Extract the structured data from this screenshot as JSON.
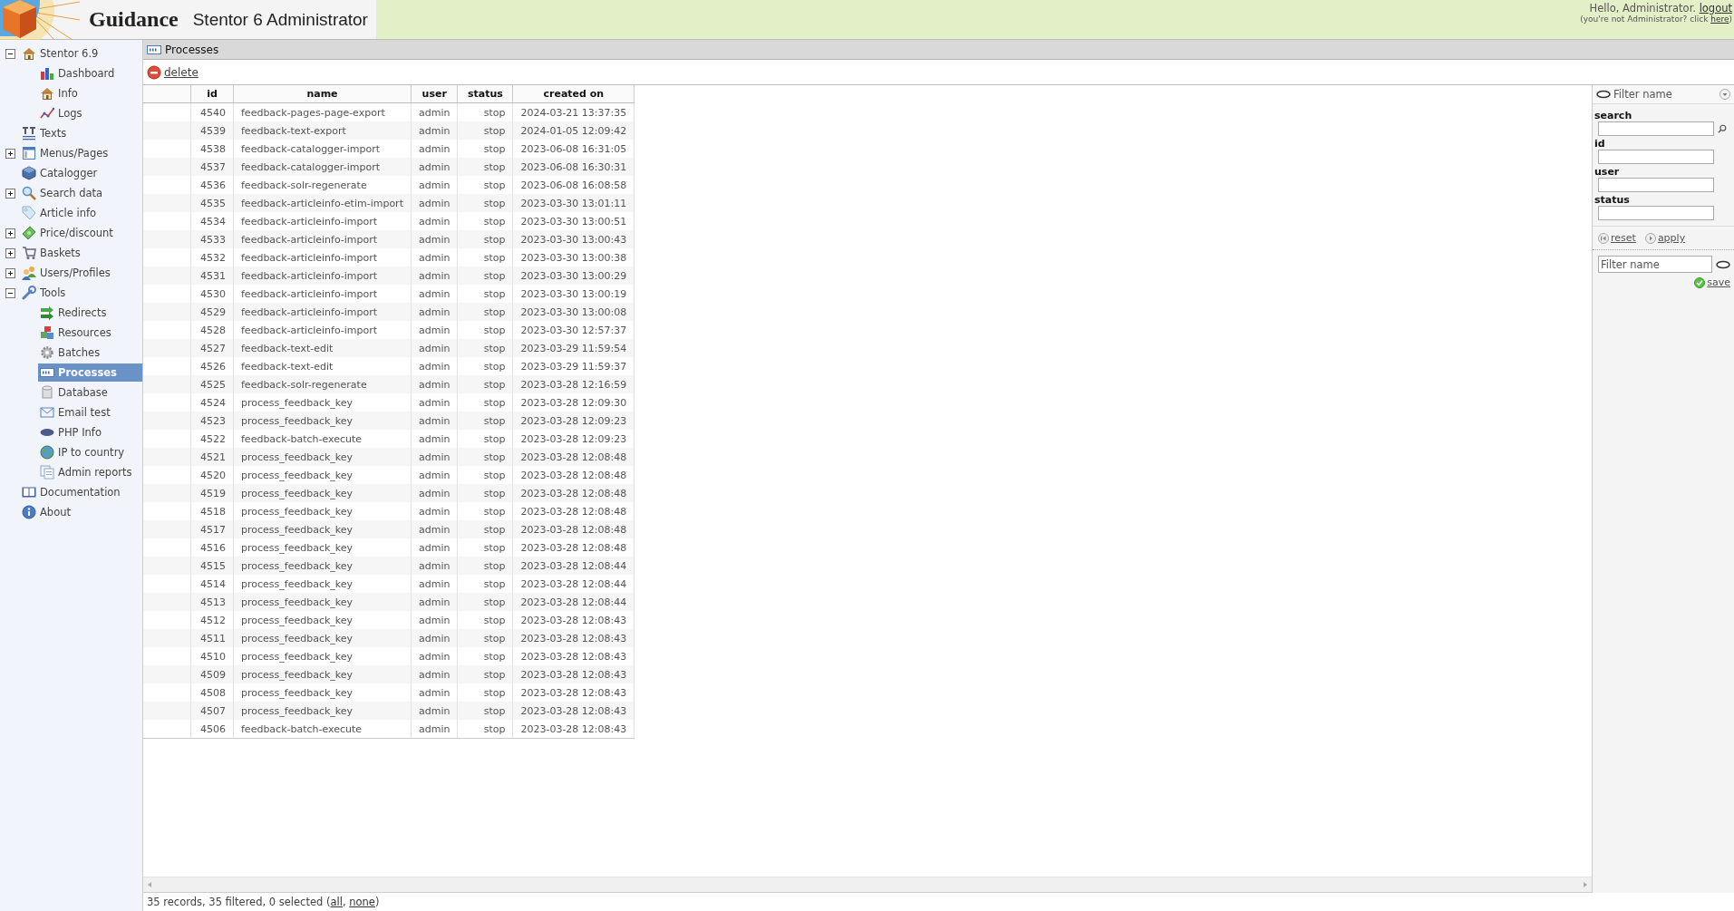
{
  "header": {
    "brand": "Guidance",
    "product": "Stentor 6 Administrator",
    "greeting": [
      {
        "kind": "text",
        "text": "Hello, Administrator. "
      },
      {
        "kind": "link",
        "text": "logout"
      }
    ],
    "notice": [
      {
        "kind": "text",
        "text": "(you're not Administrator? click "
      },
      {
        "kind": "link",
        "text": "here"
      },
      {
        "kind": "text",
        "text": ")"
      }
    ]
  },
  "sidebar": {
    "items": [
      {
        "label": "Stentor 6.9",
        "expanded": true,
        "selected": false,
        "children": [
          {
            "label": "Dashboard",
            "selected": false
          },
          {
            "label": "Info",
            "selected": false
          },
          {
            "label": "Logs",
            "selected": false
          }
        ]
      },
      {
        "label": "Texts",
        "selected": false
      },
      {
        "label": "Menus/Pages",
        "expanded": false,
        "selected": false
      },
      {
        "label": "Catalogger",
        "selected": false
      },
      {
        "label": "Search data",
        "expanded": false,
        "selected": false
      },
      {
        "label": "Article info",
        "selected": false
      },
      {
        "label": "Price/discount",
        "expanded": false,
        "selected": false
      },
      {
        "label": "Baskets",
        "expanded": false,
        "selected": false
      },
      {
        "label": "Users/Profiles",
        "expanded": false,
        "selected": false
      },
      {
        "label": "Tools",
        "expanded": true,
        "selected": false,
        "children": [
          {
            "label": "Redirects",
            "selected": false
          },
          {
            "label": "Resources",
            "selected": false
          },
          {
            "label": "Batches",
            "selected": false
          },
          {
            "label": "Processes",
            "selected": true
          },
          {
            "label": "Database",
            "selected": false
          },
          {
            "label": "Email test",
            "selected": false
          },
          {
            "label": "PHP Info",
            "selected": false
          },
          {
            "label": "IP to country",
            "selected": false
          },
          {
            "label": "Admin reports",
            "selected": false
          }
        ]
      },
      {
        "label": "Documentation",
        "selected": false
      },
      {
        "label": "About",
        "selected": false
      }
    ]
  },
  "panel": {
    "title": "Processes",
    "toolbar": [
      {
        "label": "delete"
      }
    ]
  },
  "table": {
    "columns": [
      "id",
      "name",
      "user",
      "status",
      "created on"
    ],
    "rows": [
      {
        "selected": false,
        "cells": [
          "4540",
          "feedback-pages-page-export",
          "admin",
          "stop",
          "2024-03-21 13:37:35"
        ]
      },
      {
        "selected": false,
        "cells": [
          "4539",
          "feedback-text-export",
          "admin",
          "stop",
          "2024-01-05 12:09:42"
        ]
      },
      {
        "selected": false,
        "cells": [
          "4538",
          "feedback-catalogger-import",
          "admin",
          "stop",
          "2023-06-08 16:31:05"
        ]
      },
      {
        "selected": false,
        "cells": [
          "4537",
          "feedback-catalogger-import",
          "admin",
          "stop",
          "2023-06-08 16:30:31"
        ]
      },
      {
        "selected": false,
        "cells": [
          "4536",
          "feedback-solr-regenerate",
          "admin",
          "stop",
          "2023-06-08 16:08:58"
        ]
      },
      {
        "selected": false,
        "cells": [
          "4535",
          "feedback-articleinfo-etim-import",
          "admin",
          "stop",
          "2023-03-30 13:01:11"
        ]
      },
      {
        "selected": false,
        "cells": [
          "4534",
          "feedback-articleinfo-import",
          "admin",
          "stop",
          "2023-03-30 13:00:51"
        ]
      },
      {
        "selected": false,
        "cells": [
          "4533",
          "feedback-articleinfo-import",
          "admin",
          "stop",
          "2023-03-30 13:00:43"
        ]
      },
      {
        "selected": false,
        "cells": [
          "4532",
          "feedback-articleinfo-import",
          "admin",
          "stop",
          "2023-03-30 13:00:38"
        ]
      },
      {
        "selected": false,
        "cells": [
          "4531",
          "feedback-articleinfo-import",
          "admin",
          "stop",
          "2023-03-30 13:00:29"
        ]
      },
      {
        "selected": false,
        "cells": [
          "4530",
          "feedback-articleinfo-import",
          "admin",
          "stop",
          "2023-03-30 13:00:19"
        ]
      },
      {
        "selected": false,
        "cells": [
          "4529",
          "feedback-articleinfo-import",
          "admin",
          "stop",
          "2023-03-30 13:00:08"
        ]
      },
      {
        "selected": false,
        "cells": [
          "4528",
          "feedback-articleinfo-import",
          "admin",
          "stop",
          "2023-03-30 12:57:37"
        ]
      },
      {
        "selected": false,
        "cells": [
          "4527",
          "feedback-text-edit",
          "admin",
          "stop",
          "2023-03-29 11:59:54"
        ]
      },
      {
        "selected": false,
        "cells": [
          "4526",
          "feedback-text-edit",
          "admin",
          "stop",
          "2023-03-29 11:59:37"
        ]
      },
      {
        "selected": false,
        "cells": [
          "4525",
          "feedback-solr-regenerate",
          "admin",
          "stop",
          "2023-03-28 12:16:59"
        ]
      },
      {
        "selected": false,
        "cells": [
          "4524",
          "process_feedback_key",
          "admin",
          "stop",
          "2023-03-28 12:09:30"
        ]
      },
      {
        "selected": false,
        "cells": [
          "4523",
          "process_feedback_key",
          "admin",
          "stop",
          "2023-03-28 12:09:23"
        ]
      },
      {
        "selected": false,
        "cells": [
          "4522",
          "feedback-batch-execute",
          "admin",
          "stop",
          "2023-03-28 12:09:23"
        ]
      },
      {
        "selected": false,
        "cells": [
          "4521",
          "process_feedback_key",
          "admin",
          "stop",
          "2023-03-28 12:08:48"
        ]
      },
      {
        "selected": false,
        "cells": [
          "4520",
          "process_feedback_key",
          "admin",
          "stop",
          "2023-03-28 12:08:48"
        ]
      },
      {
        "selected": false,
        "cells": [
          "4519",
          "process_feedback_key",
          "admin",
          "stop",
          "2023-03-28 12:08:48"
        ]
      },
      {
        "selected": false,
        "cells": [
          "4518",
          "process_feedback_key",
          "admin",
          "stop",
          "2023-03-28 12:08:48"
        ]
      },
      {
        "selected": false,
        "cells": [
          "4517",
          "process_feedback_key",
          "admin",
          "stop",
          "2023-03-28 12:08:48"
        ]
      },
      {
        "selected": false,
        "cells": [
          "4516",
          "process_feedback_key",
          "admin",
          "stop",
          "2023-03-28 12:08:48"
        ]
      },
      {
        "selected": false,
        "cells": [
          "4515",
          "process_feedback_key",
          "admin",
          "stop",
          "2023-03-28 12:08:44"
        ]
      },
      {
        "selected": false,
        "cells": [
          "4514",
          "process_feedback_key",
          "admin",
          "stop",
          "2023-03-28 12:08:44"
        ]
      },
      {
        "selected": false,
        "cells": [
          "4513",
          "process_feedback_key",
          "admin",
          "stop",
          "2023-03-28 12:08:44"
        ]
      },
      {
        "selected": false,
        "cells": [
          "4512",
          "process_feedback_key",
          "admin",
          "stop",
          "2023-03-28 12:08:43"
        ]
      },
      {
        "selected": false,
        "cells": [
          "4511",
          "process_feedback_key",
          "admin",
          "stop",
          "2023-03-28 12:08:43"
        ]
      },
      {
        "selected": false,
        "cells": [
          "4510",
          "process_feedback_key",
          "admin",
          "stop",
          "2023-03-28 12:08:43"
        ]
      },
      {
        "selected": false,
        "cells": [
          "4509",
          "process_feedback_key",
          "admin",
          "stop",
          "2023-03-28 12:08:43"
        ]
      },
      {
        "selected": false,
        "cells": [
          "4508",
          "process_feedback_key",
          "admin",
          "stop",
          "2023-03-28 12:08:43"
        ]
      },
      {
        "selected": false,
        "cells": [
          "4507",
          "process_feedback_key",
          "admin",
          "stop",
          "2023-03-28 12:08:43"
        ]
      },
      {
        "selected": false,
        "cells": [
          "4506",
          "feedback-batch-execute",
          "admin",
          "stop",
          "2023-03-28 12:08:43"
        ]
      }
    ]
  },
  "filter": {
    "title": "Filter name",
    "fields": [
      {
        "label": "search",
        "kind": "search"
      },
      {
        "label": "id",
        "kind": "text"
      },
      {
        "label": "user",
        "kind": "text"
      },
      {
        "label": "status",
        "kind": "text"
      }
    ],
    "actions": [
      {
        "label": "reset",
        "kind": "reset"
      },
      {
        "label": "apply",
        "kind": "apply"
      }
    ],
    "name_field": {
      "placeholder": "Filter name"
    },
    "save": "save"
  },
  "status_bar": [
    {
      "kind": "text",
      "text": "35 records, 35 filtered, 0 selected ("
    },
    {
      "kind": "link",
      "text": "all"
    },
    {
      "kind": "text",
      "text": ", "
    },
    {
      "kind": "link",
      "text": "none"
    },
    {
      "kind": "text",
      "text": ")"
    }
  ]
}
